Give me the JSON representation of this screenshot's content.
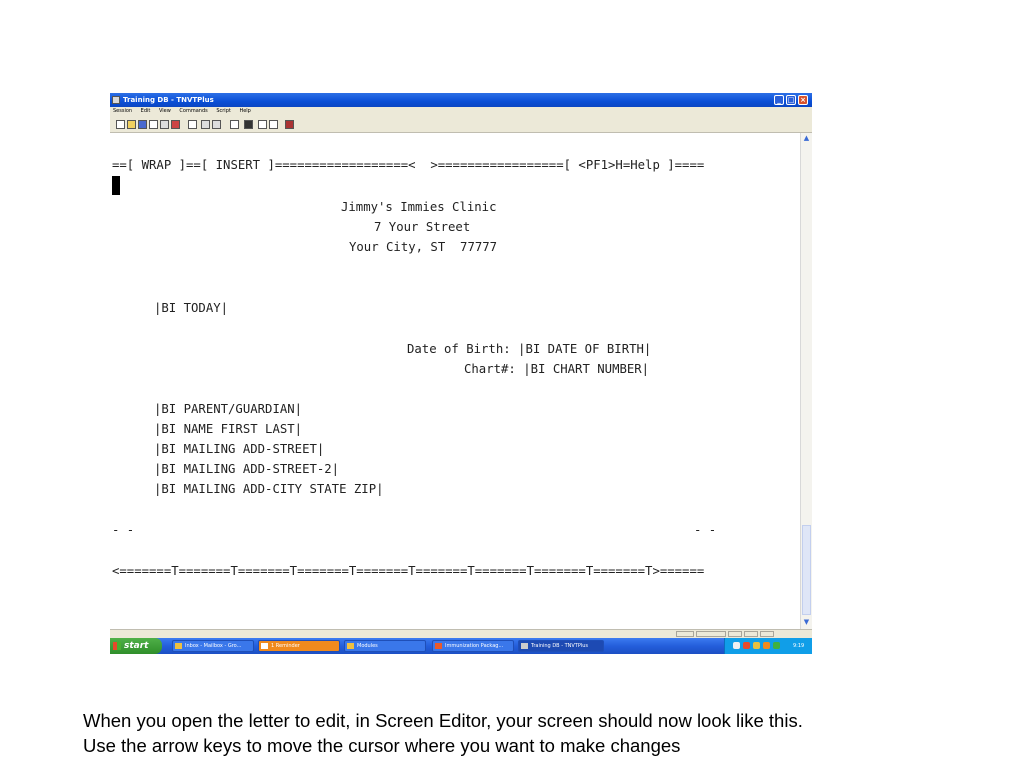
{
  "window": {
    "title": "Training DB - TNVTPlus",
    "menu": [
      "Session",
      "Edit",
      "View",
      "Commands",
      "Script",
      "Help"
    ]
  },
  "terminal": {
    "status_line": "==[ WRAP ]==[ INSERT ]==================<  >=================[ <PF1>H=Help ]====",
    "clinic_name": "Jimmy's Immies Clinic",
    "street": "7 Your Street",
    "city_line": "Your City, ST  77777",
    "today_field": "|BI TODAY|",
    "dob_line": "Date of Birth: |BI DATE OF BIRTH|",
    "chart_line": "Chart#: |BI CHART NUMBER|",
    "address_lines": [
      "|BI PARENT/GUARDIAN|",
      "|BI NAME FIRST LAST|",
      "|BI MAILING ADD-STREET|",
      "|BI MAILING ADD-STREET-2|",
      "|BI MAILING ADD-CITY STATE ZIP|"
    ],
    "margin_left": "- -",
    "margin_right": "- -",
    "ruler": "<=======T=======T=======T=======T=======T=======T=======T=======T=======T>======"
  },
  "taskbar": {
    "start_label": "start",
    "tasks": [
      "Inbox - Mailbox - Gro...",
      "1 Reminder",
      "Modules",
      "Immunization Packag...",
      "Training DB - TNVTPlus"
    ],
    "clock": "9:19 AM"
  },
  "caption": {
    "line1": "When you open the letter to edit, in Screen Editor, your screen should now look like this.",
    "line2": "Use the arrow keys to move the cursor where you want to make changes"
  }
}
